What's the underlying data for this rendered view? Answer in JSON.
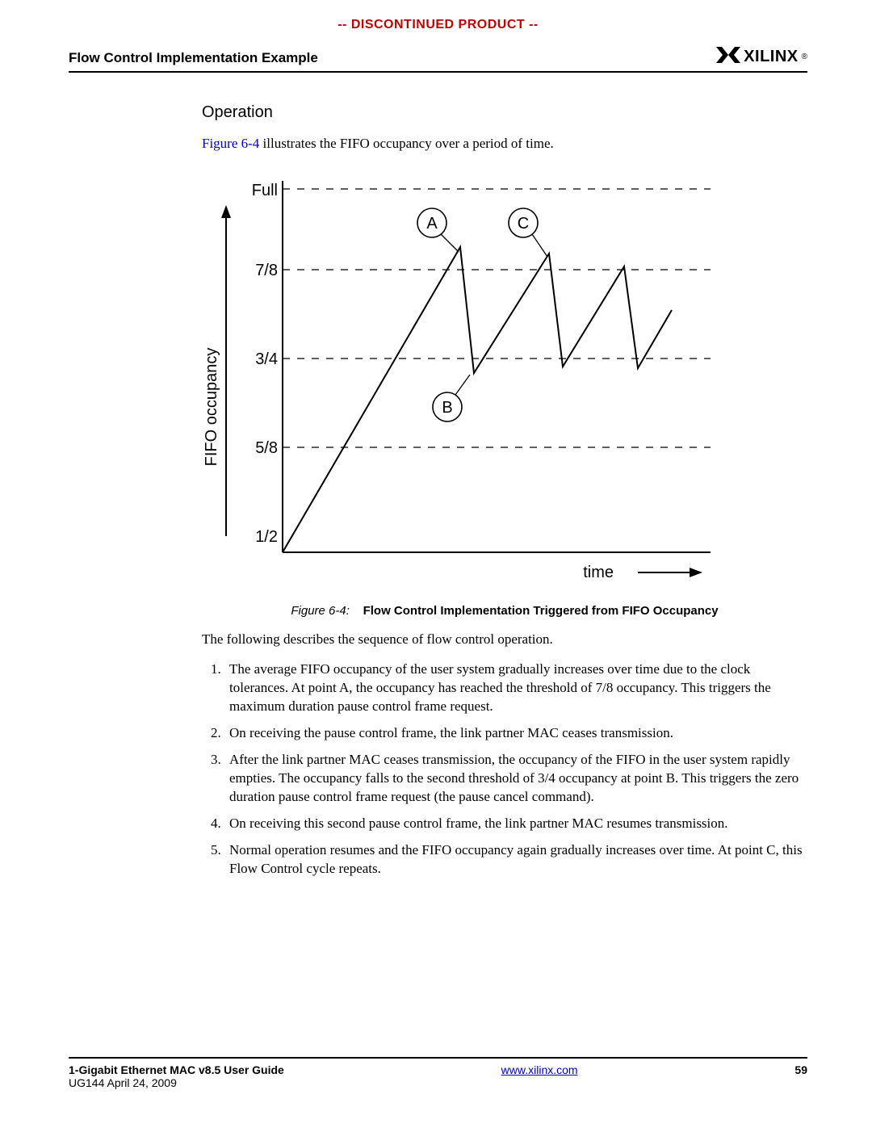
{
  "banner": "-- DISCONTINUED PRODUCT --",
  "header": {
    "title": "Flow Control Implementation Example",
    "logo_text": "XILINX",
    "logo_reg": "®"
  },
  "content": {
    "sub_heading": "Operation",
    "intro_link": "Figure 6-4",
    "intro_rest": " illustrates the FIFO occupancy over a period of time.",
    "caption_label": "Figure 6-4:",
    "caption_title": "Flow Control Implementation Triggered from FIFO Occupancy",
    "para_after": "The following describes the sequence of flow control operation.",
    "steps": [
      "The average FIFO occupancy of the user system gradually increases over time due to the clock tolerances. At point A, the occupancy has reached the threshold of 7/8 occupancy. This triggers the maximum duration pause control frame request.",
      "On receiving the pause control frame, the link partner MAC ceases transmission.",
      "After the link partner MAC ceases transmission, the occupancy of the FIFO in the user system rapidly empties. The occupancy falls to the second threshold of 3/4 occupancy at point B. This triggers the zero duration pause control frame request (the pause cancel command).",
      "On receiving this second pause control frame, the link partner MAC resumes transmission.",
      "Normal operation resumes and the FIFO occupancy again gradually increases over time. At point C, this Flow Control cycle repeats."
    ]
  },
  "chart_data": {
    "type": "line",
    "title": "",
    "xlabel": "time",
    "ylabel": "FIFO occupancy",
    "y_ticks": [
      "1/2",
      "5/8",
      "3/4",
      "7/8",
      "Full"
    ],
    "y_tick_values": [
      0.5,
      0.625,
      0.75,
      0.875,
      1.0
    ],
    "series": [
      {
        "name": "occupancy",
        "segments": [
          [
            [
              0,
              0.5
            ],
            [
              260,
              0.92
            ]
          ],
          [
            [
              260,
              0.92
            ],
            [
              280,
              0.73
            ]
          ],
          [
            [
              280,
              0.73
            ],
            [
              390,
              0.91
            ]
          ],
          [
            [
              390,
              0.91
            ],
            [
              410,
              0.74
            ]
          ],
          [
            [
              410,
              0.74
            ],
            [
              500,
              0.89
            ]
          ],
          [
            [
              500,
              0.89
            ],
            [
              520,
              0.745
            ]
          ],
          [
            [
              520,
              0.745
            ],
            [
              570,
              0.83
            ]
          ]
        ]
      }
    ],
    "annotations": [
      {
        "label": "A",
        "x": 260,
        "y": 0.96
      },
      {
        "label": "C",
        "x": 390,
        "y": 0.96
      },
      {
        "label": "B",
        "x": 280,
        "y": 0.69
      }
    ],
    "xlim": [
      0,
      570
    ],
    "ylim": [
      0.5,
      1.0
    ]
  },
  "footer": {
    "title": "1-Gigabit Ethernet MAC v8.5 User Guide",
    "sub": "UG144 April 24, 2009",
    "url": "www.xilinx.com",
    "page": "59"
  }
}
